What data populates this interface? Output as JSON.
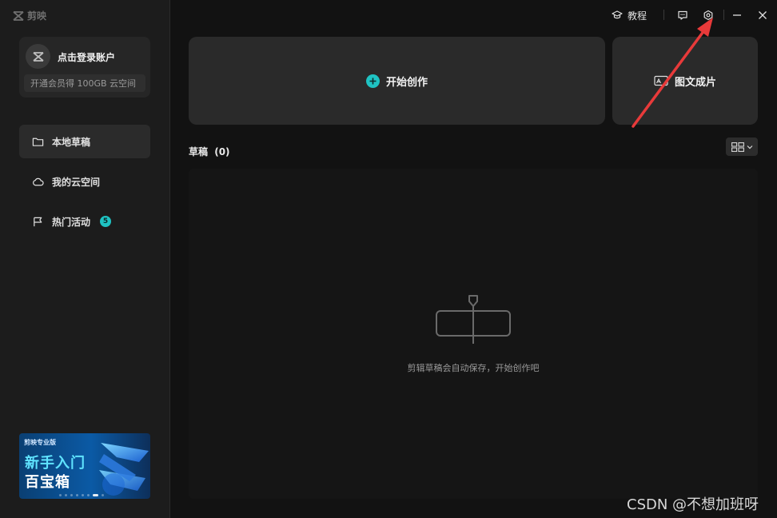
{
  "app": {
    "name": "剪映"
  },
  "account": {
    "login_label": "点击登录账户",
    "vip_promo": "开通会员得 100GB 云空间"
  },
  "sidebar": {
    "items": [
      {
        "label": "本地草稿",
        "icon": "folder-icon",
        "active": true
      },
      {
        "label": "我的云空间",
        "icon": "cloud-icon",
        "active": false
      },
      {
        "label": "热门活动",
        "icon": "flag-icon",
        "active": false,
        "badge": "5"
      }
    ]
  },
  "banner": {
    "brand": "剪映专业版",
    "line1": "新手入门",
    "line2": "百宝箱"
  },
  "topbar": {
    "tutorial_label": "教程",
    "feedback_icon": "feedback-icon",
    "settings_icon": "settings-icon",
    "minimize_icon": "minimize-icon",
    "close_icon": "close-icon"
  },
  "actions": {
    "start_create": "开始创作",
    "image_to_video": "图文成片"
  },
  "drafts": {
    "title": "草稿",
    "count": "(0)",
    "empty_text": "剪辑草稿会自动保存，开始创作吧"
  },
  "watermark": "CSDN @不想加班呀",
  "colors": {
    "accent": "#1fc3c3",
    "background": "#121212",
    "sidebar": "#1c1c1c",
    "card": "#2a2a2a",
    "annotation_arrow": "#e83a3a"
  }
}
